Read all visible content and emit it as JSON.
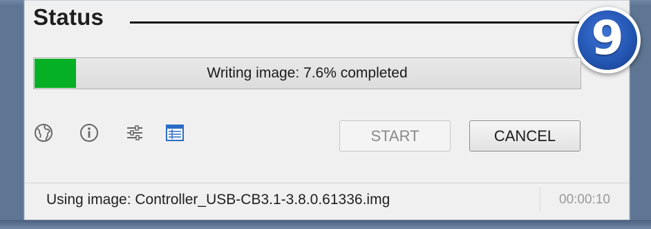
{
  "status_section": {
    "heading": "Status",
    "step_badge": "9"
  },
  "progress": {
    "label": "Writing image: 7.6% completed",
    "percent": 7.6,
    "fill_color": "#06b025"
  },
  "toolbar": {
    "icons": [
      "globe-icon",
      "info-icon",
      "settings-sliders-icon",
      "log-icon"
    ],
    "accent_color": "#2b6cc4"
  },
  "buttons": {
    "start_label": "START",
    "cancel_label": "CANCEL"
  },
  "status_bar": {
    "text": "Using image: Controller_USB-CB3.1-3.8.0.61336.img",
    "elapsed": "00:00:10"
  }
}
